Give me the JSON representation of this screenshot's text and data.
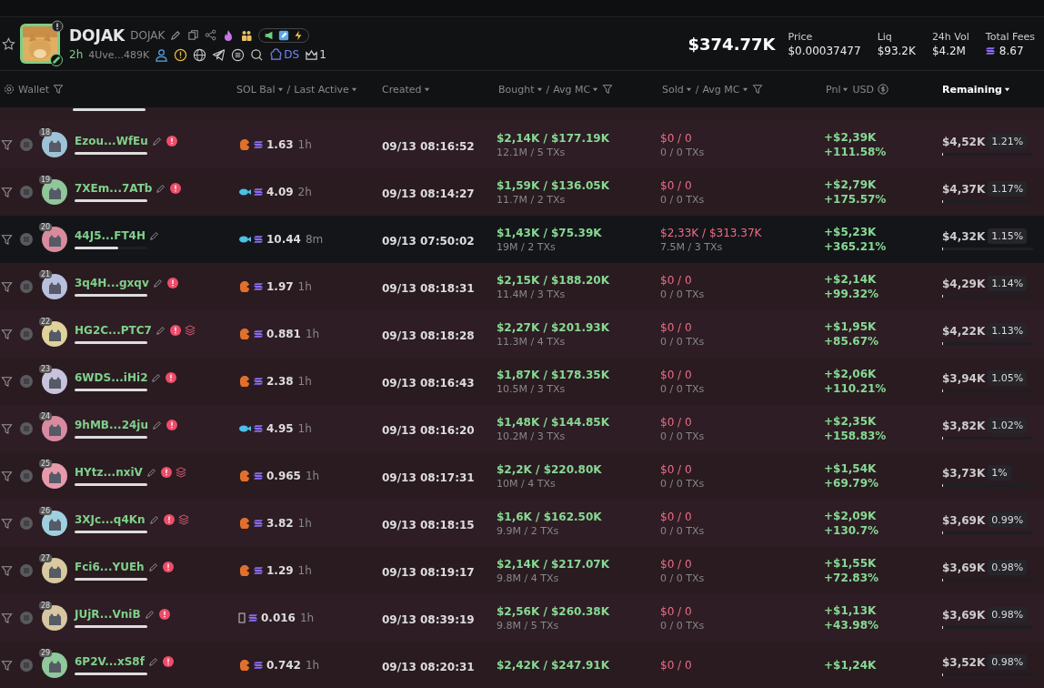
{
  "token": {
    "name": "DOJAK",
    "symbol": "DOJAK",
    "age": "2h",
    "address": "4Uve...489K",
    "ds_label": "DS",
    "crown_count": "1",
    "market_cap": "$374.77K"
  },
  "stats": [
    {
      "label": "Price",
      "value": "$0.00037477",
      "kind": "plain"
    },
    {
      "label": "Liq",
      "value": "$93.2K",
      "kind": "plain"
    },
    {
      "label": "24h Vol",
      "value": "$4.2M",
      "kind": "plain"
    },
    {
      "label": "Total Fees",
      "value": "8.67",
      "kind": "sol"
    }
  ],
  "columns": [
    {
      "kind": "wallet",
      "parts": [
        {
          "text": "Wallet",
          "caret": false
        }
      ],
      "active": false
    },
    {
      "kind": "plain",
      "parts": [
        {
          "text": "SOL Bal",
          "caret": true
        },
        {
          "text": "/",
          "caret": false
        },
        {
          "text": "Last Active",
          "caret": true
        }
      ],
      "active": false
    },
    {
      "kind": "plain",
      "parts": [
        {
          "text": "Created",
          "caret": true
        }
      ],
      "active": false
    },
    {
      "kind": "filter",
      "parts": [
        {
          "text": "Bought",
          "caret": true
        },
        {
          "text": "/",
          "caret": false
        },
        {
          "text": "Avg MC",
          "caret": true
        }
      ],
      "active": false
    },
    {
      "kind": "filter",
      "parts": [
        {
          "text": "Sold",
          "caret": true
        },
        {
          "text": "/",
          "caret": false
        },
        {
          "text": "Avg MC",
          "caret": true
        }
      ],
      "active": false
    },
    {
      "kind": "currency",
      "parts": [
        {
          "text": "Pnl",
          "caret": true
        },
        {
          "text": "USD",
          "caret": false
        }
      ],
      "active": false
    },
    {
      "kind": "plain",
      "parts": [
        {
          "text": "Remaining",
          "caret": true
        }
      ],
      "active": true
    }
  ],
  "clipped_row": {
    "level": 1
  },
  "rows": [
    {
      "rank": "18",
      "color": "#9fc3d6",
      "wallet": "Ezou...WfEu",
      "level": 1,
      "warning": true,
      "bundle": false,
      "kind": "shrimp",
      "sol": "1.63",
      "last": "1h",
      "created": "09/13 08:16:52",
      "bought": "$2,14K / $177.19K",
      "bought_sub": "12.1M / 5 TXs",
      "sold": "$0 / 0",
      "sold_sub": "0 / 0 TXs",
      "pnl": "+$2,39K",
      "pnl_pct": "+111.58%",
      "remaining": "$4,52K",
      "share": "1.21%",
      "highlighted": false
    },
    {
      "rank": "19",
      "color": "#8fc79a",
      "wallet": "7XEm...7ATb",
      "level": 1,
      "warning": true,
      "bundle": false,
      "kind": "fish",
      "sol": "4.09",
      "last": "2h",
      "created": "09/13 08:14:27",
      "bought": "$1,59K / $136.05K",
      "bought_sub": "11.7M / 2 TXs",
      "sold": "$0 / 0",
      "sold_sub": "0 / 0 TXs",
      "pnl": "+$2,79K",
      "pnl_pct": "+175.57%",
      "remaining": "$4,37K",
      "share": "1.17%",
      "highlighted": false
    },
    {
      "rank": "20",
      "color": "#d98a9c",
      "wallet": "44J5...FT4H",
      "level": 0.6,
      "warning": false,
      "bundle": false,
      "kind": "fish",
      "sol": "10.44",
      "last": "8m",
      "created": "09/13 07:50:02",
      "bought": "$1,43K / $75.39K",
      "bought_sub": "19M / 2 TXs",
      "sold": "$2,33K / $313.37K",
      "sold_sub": "7.5M / 3 TXs",
      "pnl": "+$5,23K",
      "pnl_pct": "+365.21%",
      "remaining": "$4,32K",
      "share": "1.15%",
      "highlighted": true
    },
    {
      "rank": "21",
      "color": "#b9c0de",
      "wallet": "3q4H...gxqv",
      "level": 1,
      "warning": true,
      "bundle": false,
      "kind": "shrimp",
      "sol": "1.97",
      "last": "1h",
      "created": "09/13 08:18:31",
      "bought": "$2,15K / $188.20K",
      "bought_sub": "11.4M / 3 TXs",
      "sold": "$0 / 0",
      "sold_sub": "0 / 0 TXs",
      "pnl": "+$2,14K",
      "pnl_pct": "+99.32%",
      "remaining": "$4,29K",
      "share": "1.14%",
      "highlighted": false
    },
    {
      "rank": "22",
      "color": "#e0d29a",
      "wallet": "HG2C...PTC7",
      "level": 1,
      "warning": true,
      "bundle": true,
      "kind": "shrimp",
      "sol": "0.881",
      "last": "1h",
      "created": "09/13 08:18:28",
      "bought": "$2,27K / $201.93K",
      "bought_sub": "11.3M / 4 TXs",
      "sold": "$0 / 0",
      "sold_sub": "0 / 0 TXs",
      "pnl": "+$1,95K",
      "pnl_pct": "+85.67%",
      "remaining": "$4,22K",
      "share": "1.13%",
      "highlighted": false
    },
    {
      "rank": "23",
      "color": "#c8c3dc",
      "wallet": "6WDS...iHi2",
      "level": 1,
      "warning": true,
      "bundle": false,
      "kind": "shrimp",
      "sol": "2.38",
      "last": "1h",
      "created": "09/13 08:16:43",
      "bought": "$1,87K / $178.35K",
      "bought_sub": "10.5M / 3 TXs",
      "sold": "$0 / 0",
      "sold_sub": "0 / 0 TXs",
      "pnl": "+$2,06K",
      "pnl_pct": "+110.21%",
      "remaining": "$3,94K",
      "share": "1.05%",
      "highlighted": false
    },
    {
      "rank": "24",
      "color": "#d98aa0",
      "wallet": "9hMB...24ju",
      "level": 1,
      "warning": true,
      "bundle": false,
      "kind": "fish",
      "sol": "4.95",
      "last": "1h",
      "created": "09/13 08:16:20",
      "bought": "$1,48K / $144.85K",
      "bought_sub": "10.2M / 3 TXs",
      "sold": "$0 / 0",
      "sold_sub": "0 / 0 TXs",
      "pnl": "+$2,35K",
      "pnl_pct": "+158.83%",
      "remaining": "$3,82K",
      "share": "1.02%",
      "highlighted": false
    },
    {
      "rank": "25",
      "color": "#e69aaa",
      "wallet": "HYtz...nxiV",
      "level": 1,
      "warning": true,
      "bundle": true,
      "kind": "shrimp",
      "sol": "0.965",
      "last": "1h",
      "created": "09/13 08:17:31",
      "bought": "$2,2K / $220.80K",
      "bought_sub": "10M / 4 TXs",
      "sold": "$0 / 0",
      "sold_sub": "0 / 0 TXs",
      "pnl": "+$1,54K",
      "pnl_pct": "+69.79%",
      "remaining": "$3,73K",
      "share": "1%",
      "highlighted": false
    },
    {
      "rank": "26",
      "color": "#9fd0e0",
      "wallet": "3XJc...q4Kn",
      "level": 1,
      "warning": true,
      "bundle": true,
      "kind": "shrimp",
      "sol": "3.82",
      "last": "1h",
      "created": "09/13 08:18:15",
      "bought": "$1,6K / $162.50K",
      "bought_sub": "9.9M / 2 TXs",
      "sold": "$0 / 0",
      "sold_sub": "0 / 0 TXs",
      "pnl": "+$2,09K",
      "pnl_pct": "+130.7%",
      "remaining": "$3,69K",
      "share": "0.99%",
      "highlighted": false
    },
    {
      "rank": "27",
      "color": "#d8c9a0",
      "wallet": "Fci6...YUEh",
      "level": 1,
      "warning": true,
      "bundle": false,
      "kind": "shrimp",
      "sol": "1.29",
      "last": "1h",
      "created": "09/13 08:19:17",
      "bought": "$2,14K / $217.07K",
      "bought_sub": "9.8M / 4 TXs",
      "sold": "$0 / 0",
      "sold_sub": "0 / 0 TXs",
      "pnl": "+$1,55K",
      "pnl_pct": "+72.83%",
      "remaining": "$3,69K",
      "share": "0.98%",
      "highlighted": false
    },
    {
      "rank": "28",
      "color": "#d6c7a2",
      "wallet": "JUjR...VniB",
      "level": 1,
      "warning": true,
      "bundle": false,
      "kind": "none",
      "sol": "0.016",
      "last": "1h",
      "created": "09/13 08:39:19",
      "bought": "$2,56K / $260.38K",
      "bought_sub": "9.8M / 5 TXs",
      "sold": "$0 / 0",
      "sold_sub": "0 / 0 TXs",
      "pnl": "+$1,13K",
      "pnl_pct": "+43.98%",
      "remaining": "$3,69K",
      "share": "0.98%",
      "highlighted": false
    },
    {
      "rank": "29",
      "color": "#8fc89b",
      "wallet": "6P2V...xS8f",
      "level": 1,
      "warning": true,
      "bundle": false,
      "kind": "shrimp",
      "sol": "0.742",
      "last": "1h",
      "created": "09/13 08:20:31",
      "bought": "$2,42K / $247.91K",
      "sold": "$0 / 0",
      "pnl": "+$1,24K",
      "remaining": "$3,52K",
      "share": "0.98%",
      "highlighted": false
    }
  ]
}
